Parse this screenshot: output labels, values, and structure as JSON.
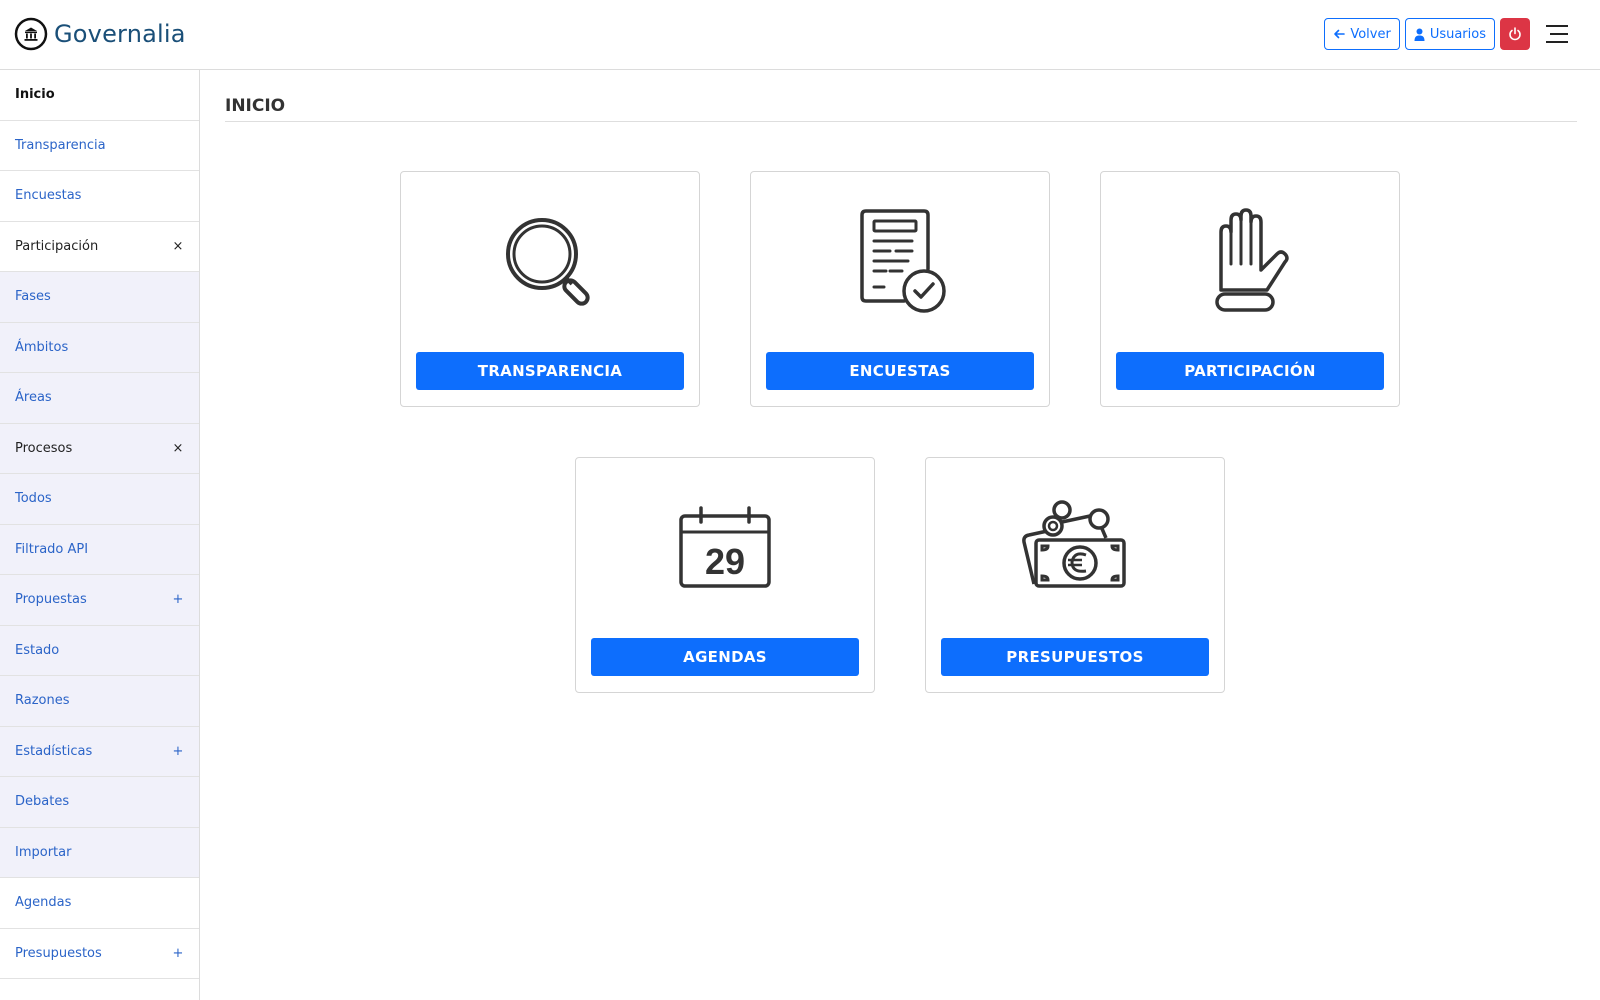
{
  "header": {
    "brand": "Governalia",
    "back_label": "Volver",
    "users_label": "Usuarios"
  },
  "sidebar": {
    "items": [
      {
        "label": "Inicio",
        "toggle": ""
      },
      {
        "label": "Transparencia",
        "toggle": ""
      },
      {
        "label": "Encuestas",
        "toggle": ""
      },
      {
        "label": "Participación",
        "toggle": "×"
      },
      {
        "label": "Fases",
        "toggle": ""
      },
      {
        "label": "Ámbitos",
        "toggle": ""
      },
      {
        "label": "Áreas",
        "toggle": ""
      },
      {
        "label": "Procesos",
        "toggle": "×"
      },
      {
        "label": "Todos",
        "toggle": ""
      },
      {
        "label": "Filtrado API",
        "toggle": ""
      },
      {
        "label": "Propuestas",
        "toggle": "+"
      },
      {
        "label": "Estado",
        "toggle": ""
      },
      {
        "label": "Razones",
        "toggle": ""
      },
      {
        "label": "Estadísticas",
        "toggle": "+"
      },
      {
        "label": "Debates",
        "toggle": ""
      },
      {
        "label": "Importar",
        "toggle": ""
      },
      {
        "label": "Agendas",
        "toggle": ""
      },
      {
        "label": "Presupuestos",
        "toggle": "+"
      }
    ]
  },
  "main": {
    "title": "INICIO",
    "cards": [
      {
        "icon": "magnifier-icon",
        "label": "TRANSPARENCIA"
      },
      {
        "icon": "survey-document-icon",
        "label": "ENCUESTAS"
      },
      {
        "icon": "raised-hand-icon",
        "label": "PARTICIPACIÓN"
      },
      {
        "icon": "calendar-icon",
        "label": "AGENDAS",
        "calendar_day": "29"
      },
      {
        "icon": "money-euro-icon",
        "label": "PRESUPUESTOS"
      }
    ]
  },
  "colors": {
    "primary": "#0d6efd",
    "danger": "#dc3545",
    "brand": "#1a4f78",
    "link": "#2b64c8"
  }
}
